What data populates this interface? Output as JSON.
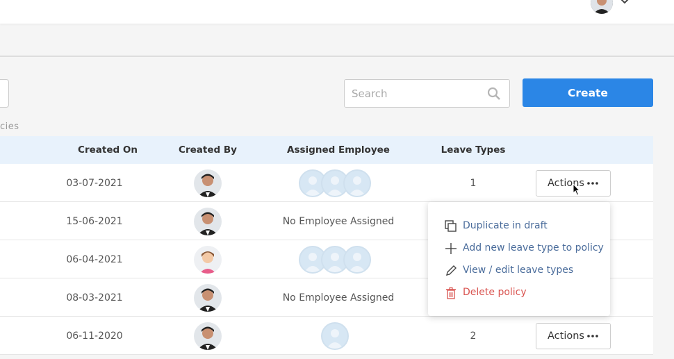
{
  "header": {
    "avatar_icon": "user-avatar-icon",
    "menu_icon": "chevron-down-icon"
  },
  "toolbar": {
    "search_placeholder": "Search",
    "create_label": "Create"
  },
  "list": {
    "subtitle": "cies"
  },
  "table": {
    "columns": [
      "Created On",
      "Created By",
      "Assigned Employee",
      "Leave Types"
    ],
    "rows": [
      {
        "created_on": "03-07-2021",
        "assigned": "",
        "leave_types": "1",
        "action_label": "Actions"
      },
      {
        "created_on": "15-06-2021",
        "assigned": "No Employee Assigned"
      },
      {
        "created_on": "06-04-2021",
        "assigned": ""
      },
      {
        "created_on": "08-03-2021",
        "assigned": "No Employee Assigned"
      },
      {
        "created_on": "06-11-2020",
        "assigned": "",
        "leave_types": "2",
        "action_label": "Actions"
      }
    ]
  },
  "actions_menu": {
    "items": [
      {
        "label": "Duplicate in draft",
        "icon": "duplicate-icon"
      },
      {
        "label": "Add new leave type to policy",
        "icon": "plus-icon"
      },
      {
        "label": "View / edit leave types",
        "icon": "pencil-icon"
      },
      {
        "label": "Delete policy",
        "icon": "trash-icon",
        "color": "#d9534f"
      }
    ]
  },
  "colors": {
    "accent": "#2b86e6",
    "header_bg": "#e8f2fc",
    "menu_text": "#4a6c9b"
  }
}
